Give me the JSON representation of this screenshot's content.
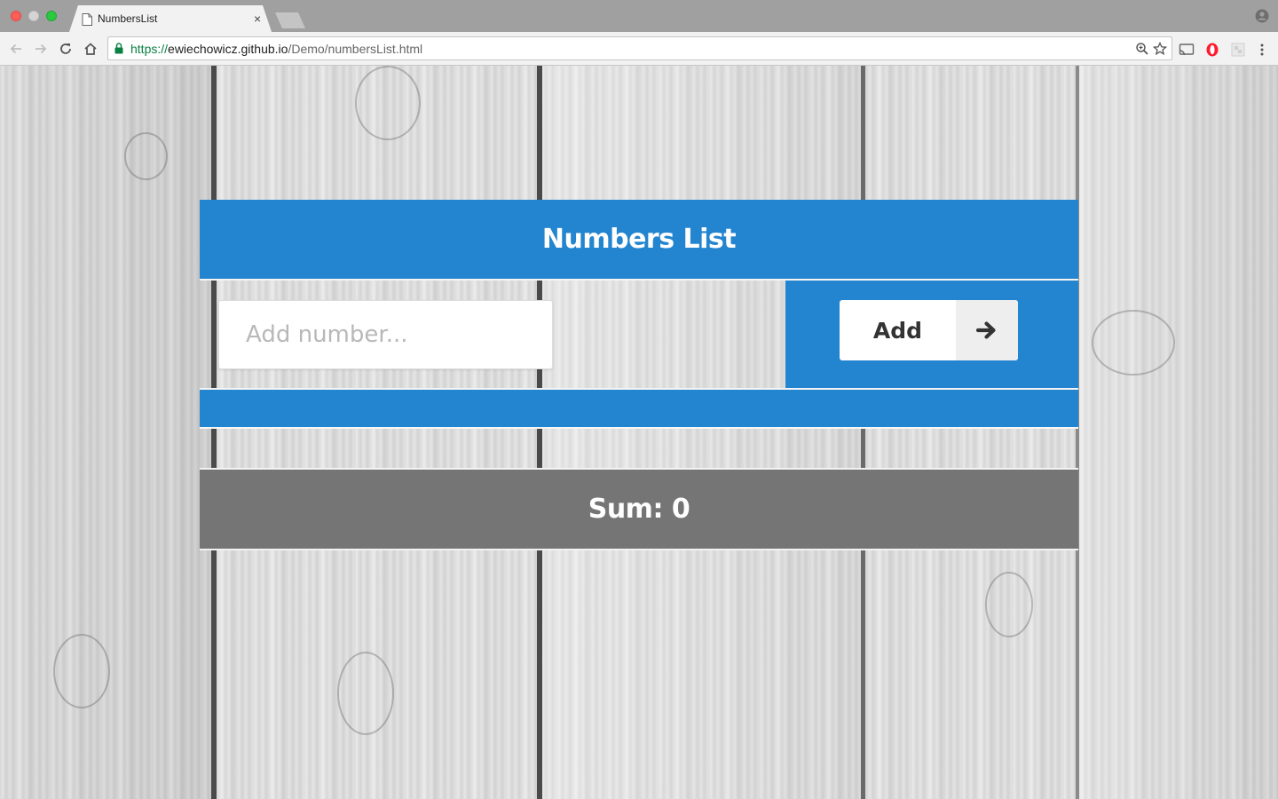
{
  "browser": {
    "tab_title": "NumbersList",
    "tab_close": "×",
    "url_scheme": "https://",
    "url_host": "ewiechowicz.github.io",
    "url_path": "/Demo/numbersList.html"
  },
  "app": {
    "title": "Numbers List",
    "input_placeholder": "Add number...",
    "input_value": "",
    "add_label": "Add",
    "sum_label": "Sum: 0",
    "colors": {
      "primary": "#2385d0",
      "sum_bar": "#757575",
      "button_bg": "#ffffff",
      "arrow_bg": "#eeeeee"
    }
  },
  "icons": {
    "arrow": "arrow-right-icon",
    "back": "back-arrow-icon",
    "forward": "forward-arrow-icon",
    "reload": "reload-icon",
    "home": "home-icon",
    "lock": "lock-icon",
    "zoom": "zoom-icon",
    "star": "bookmark-star-icon",
    "cast": "cast-icon",
    "opera": "opera-extension-icon",
    "extension": "extension-icon",
    "menu": "menu-dots-icon",
    "profile": "profile-icon"
  }
}
